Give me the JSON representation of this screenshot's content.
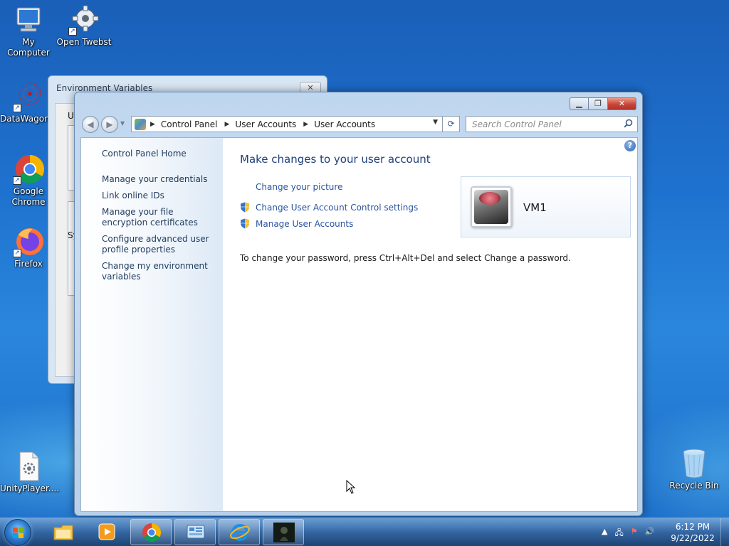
{
  "desktop": {
    "icons": [
      {
        "label": "My Computer",
        "icon": "computer-icon"
      },
      {
        "label": "Open Twebst",
        "icon": "gear-icon"
      },
      {
        "label": "DataWagon...",
        "icon": "datawagon-icon"
      },
      {
        "label": "Google Chrome",
        "icon": "chrome-icon"
      },
      {
        "label": "Firefox",
        "icon": "firefox-icon"
      },
      {
        "label": "UnityPlayer....",
        "icon": "settings-file-icon"
      },
      {
        "label": "Recycle Bin",
        "icon": "recycle-bin-icon"
      }
    ]
  },
  "back_window": {
    "title": "Environment Variables",
    "close_glyph": "✕",
    "fragment_us": "Us",
    "fragment_sy": "Sy"
  },
  "window": {
    "caption": {
      "min": "▁",
      "max": "❐",
      "close": "✕"
    },
    "nav": {
      "back": "◀",
      "forward": "▶",
      "dropdown": "▼"
    },
    "address": {
      "crumbs": [
        "Control Panel",
        "User Accounts",
        "User Accounts"
      ],
      "separator": "▶",
      "dropdown": "▼"
    },
    "refresh": "⟳",
    "search": {
      "placeholder": "Search Control Panel",
      "icon": "🔍"
    },
    "left_pane": {
      "home": "Control Panel Home",
      "items": [
        "Manage your credentials",
        "Link online IDs",
        "Manage your file encryption certificates",
        "Configure advanced user profile properties",
        "Change my environment variables"
      ]
    },
    "help": "?",
    "heading": "Make changes to your user account",
    "links": {
      "picture": "Change your picture",
      "uac": "Change User Account Control settings",
      "manage": "Manage User Accounts"
    },
    "password_note": "To change your password, press Ctrl+Alt+Del and select Change a password.",
    "account": {
      "name": "VM1"
    }
  },
  "taskbar": {
    "clock_time": "6:12 PM",
    "clock_date": "9/22/2022",
    "tray": [
      "▲",
      "🖧",
      "⚑",
      "🔊"
    ]
  },
  "colors": {
    "link": "#2a54a0",
    "heading": "#1e3f7a",
    "close_red": "#c9453a"
  }
}
